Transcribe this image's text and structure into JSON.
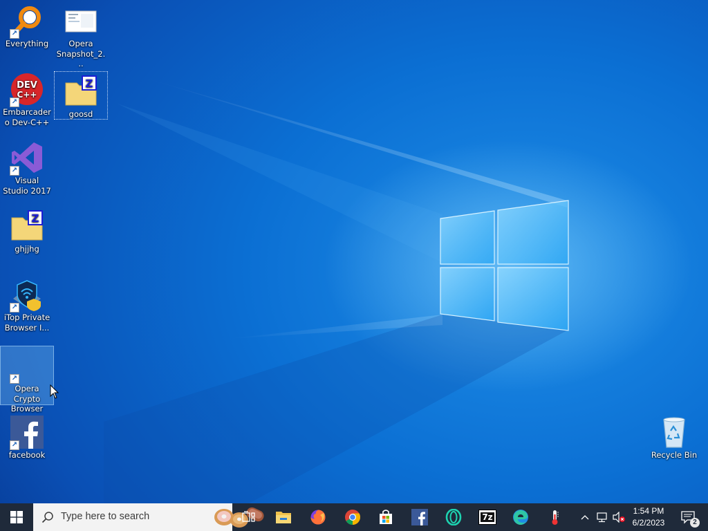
{
  "desktop": {
    "icons": [
      {
        "label": "Everything",
        "icon": "everything-magnifier-icon"
      },
      {
        "label": "Opera Snapshot_2...",
        "icon": "image-file-icon"
      },
      {
        "label": "Embarcadero Dev-C++",
        "icon": "devcpp-icon",
        "badge": "DEV C++"
      },
      {
        "label": "goosd",
        "icon": "zipped-folder-icon",
        "badge": "Z"
      },
      {
        "label": "Visual Studio 2017",
        "icon": "visual-studio-icon"
      },
      {
        "label": "ghjjhg",
        "icon": "zipped-folder-icon",
        "badge": "Z"
      },
      {
        "label": "iTop Private Browser I...",
        "icon": "itop-browser-icon"
      },
      {
        "label": "Opera Crypto Browser",
        "icon": "opera-crypto-icon"
      },
      {
        "label": "facebook",
        "icon": "facebook-icon",
        "badge": "f"
      },
      {
        "label": "Recycle Bin",
        "icon": "recycle-bin-icon"
      }
    ]
  },
  "taskbar": {
    "start_icon": "windows-logo-icon",
    "search_placeholder": "Type here to search",
    "search_icon": "search-icon",
    "apps": [
      {
        "name": "Task View",
        "icon": "task-view-icon",
        "running": false
      },
      {
        "name": "File Explorer",
        "icon": "file-explorer-icon",
        "running": false
      },
      {
        "name": "Firefox",
        "icon": "firefox-icon",
        "running": false
      },
      {
        "name": "Google Chrome",
        "icon": "chrome-icon",
        "running": false
      },
      {
        "name": "Microsoft Store",
        "icon": "store-icon",
        "running": false
      },
      {
        "name": "Facebook",
        "icon": "facebook-icon",
        "running": false
      },
      {
        "name": "Opera",
        "icon": "opera-icon",
        "running": false
      },
      {
        "name": "7-Zip",
        "icon": "7zip-icon",
        "running": false,
        "badge": "7z"
      },
      {
        "name": "Microsoft Edge",
        "icon": "edge-icon",
        "running": false
      },
      {
        "name": "Thermometer app",
        "icon": "thermometer-icon",
        "running": false
      }
    ],
    "tray": {
      "chevron_icon": "chevron-up-icon",
      "network_icon": "network-icon",
      "volume_icon": "volume-muted-icon",
      "time": "1:54 PM",
      "date": "6/2/2023",
      "notification_icon": "notification-icon",
      "notification_count": "2"
    }
  },
  "colors": {
    "taskbar_bg": "#1f2a3a",
    "desktop_blue": "#0b6fd3",
    "running_indicator": "#76b9ed"
  }
}
